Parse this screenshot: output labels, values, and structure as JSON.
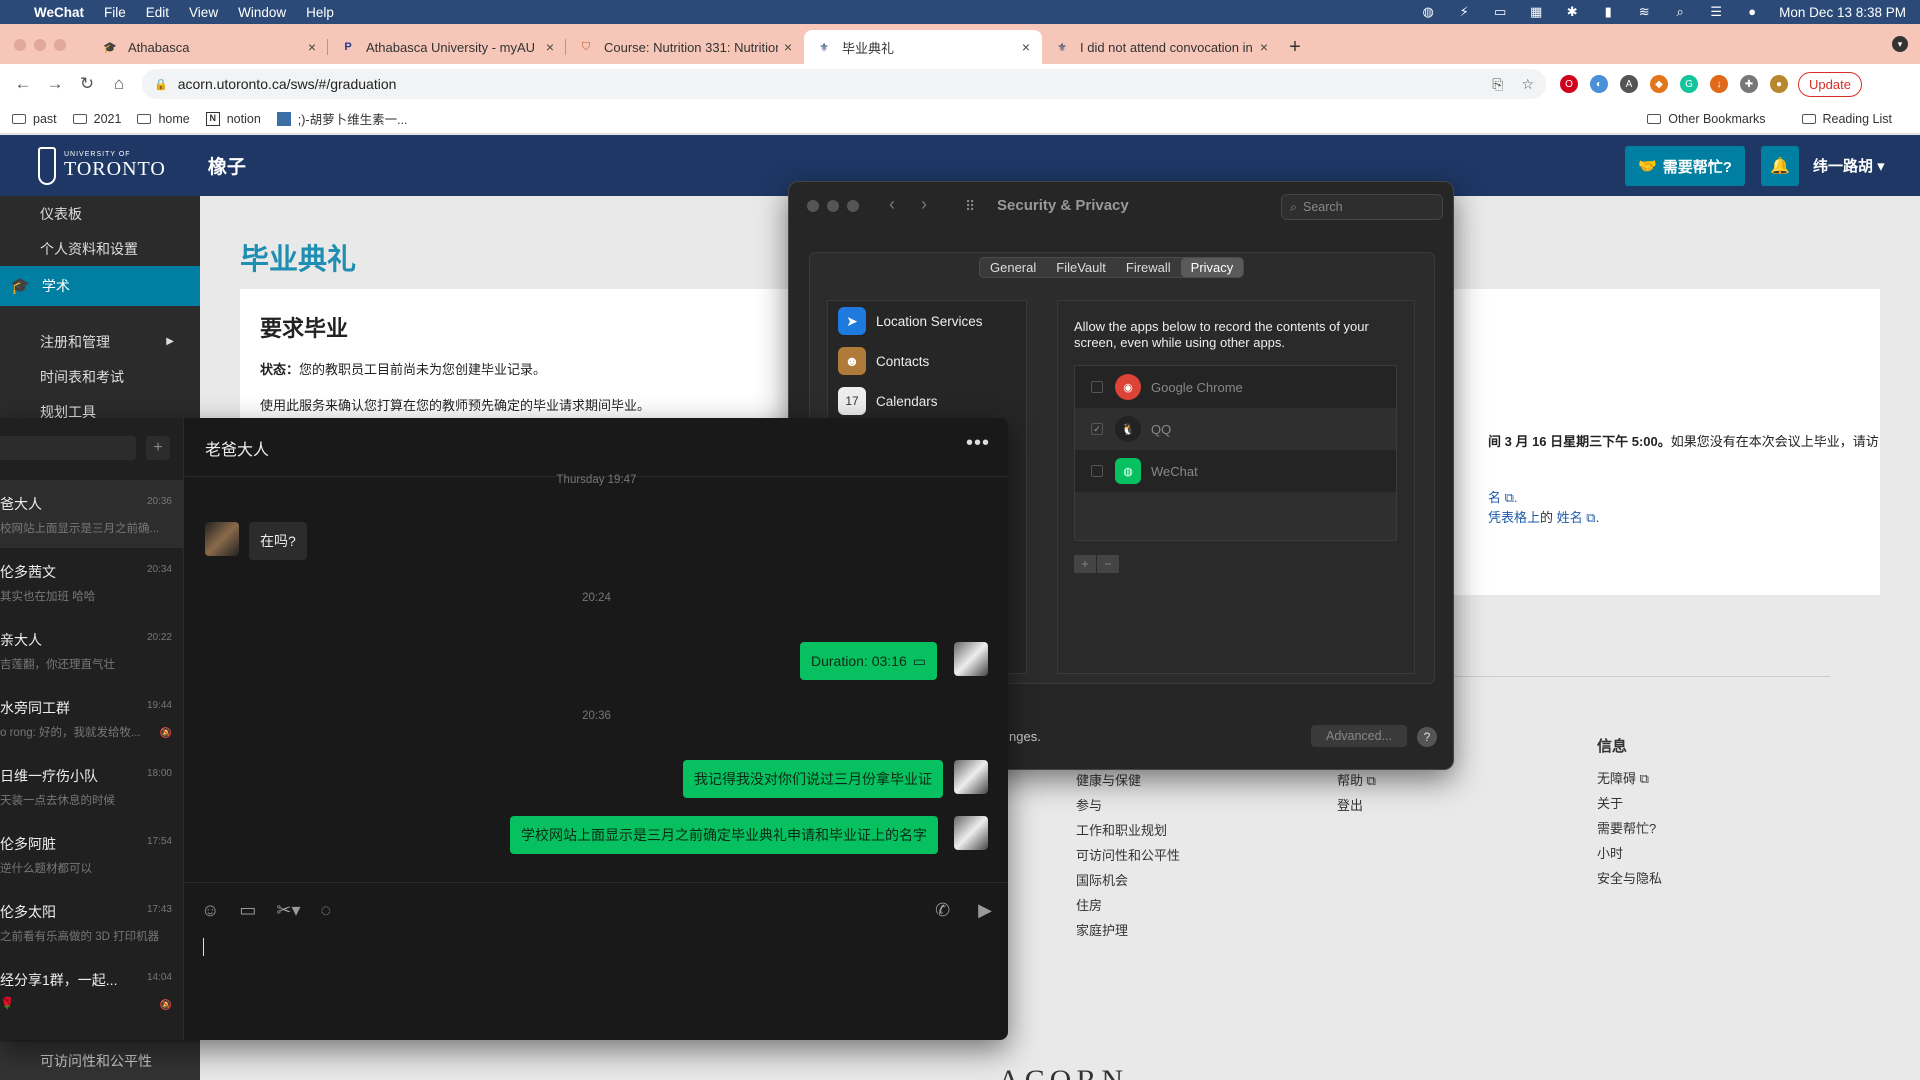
{
  "menubar": {
    "apple": "",
    "app": "WeChat",
    "items": [
      "File",
      "Edit",
      "View",
      "Window",
      "Help"
    ],
    "clock": "Mon Dec 13  8:38 PM"
  },
  "tabs": [
    {
      "title": "Athabasca"
    },
    {
      "title": "Athabasca University - myAU"
    },
    {
      "title": "Course: Nutrition 331: Nutrition"
    },
    {
      "title": "毕业典礼"
    },
    {
      "title": "I did not attend convocation in"
    }
  ],
  "address": {
    "url": "acorn.utoronto.ca/sws/#/graduation",
    "update_label": "Update"
  },
  "bookmarks": {
    "items": [
      "past",
      "2021",
      "home",
      "notion",
      ";)-胡萝卜维生素一..."
    ],
    "other": "Other Bookmarks",
    "reading": "Reading List"
  },
  "uoft": {
    "logo_small": "UNIVERSITY OF",
    "logo_big": "TORONTO",
    "site": "橡子",
    "help": "需要帮忙?",
    "user": "纬一路胡",
    "sidebar": [
      "仪表板",
      "个人资料和设置",
      "学术",
      "注册和管理",
      "时间表和考试",
      "规划工具"
    ],
    "sidebar_bottom": "可访问性和公平性",
    "page_title": "毕业典礼",
    "card_title": "要求毕业",
    "status_label": "状态：",
    "status_text": "您的教职员工目前尚未为您创建毕业记录。",
    "desc": "使用此服务来确认您打算在您的教师预先确定的毕业请求期间毕业。",
    "right_text_pre": "间 3 月 16 日星期三下午 5:00。",
    "right_text_post": "如果您没有在本次会议上毕业，请访",
    "right_link1": "名",
    "right_text2": "凭表格上",
    "right_text2_mid": "的",
    "right_link2": "姓名",
    "footer_col1": [
      "健康与保健",
      "参与",
      "工作和职业规划",
      "可访问性和公平性",
      "国际机会",
      "住房",
      "家庭护理"
    ],
    "footer_col2": [
      "帮助",
      "登出"
    ],
    "footer_col3_title": "信息",
    "footer_col3": [
      "无障碍",
      "关于",
      "需要帮忙?",
      "小时",
      "安全与隐私"
    ],
    "acorn": "ACORN"
  },
  "security": {
    "title": "Security & Privacy",
    "search_placeholder": "Search",
    "tabs": [
      "General",
      "FileVault",
      "Firewall",
      "Privacy"
    ],
    "active_tab": "Privacy",
    "list": [
      "Location Services",
      "Contacts",
      "Calendars"
    ],
    "calendar_day": "17",
    "description": "Allow the apps below to record the contents of your screen, even while using other apps.",
    "apps": [
      {
        "name": "Google Chrome",
        "checked": false
      },
      {
        "name": "QQ",
        "checked": true
      },
      {
        "name": "WeChat",
        "checked": false
      }
    ],
    "plus": "+",
    "minus": "−",
    "bottom_text": "nges.",
    "advanced": "Advanced...",
    "help": "?"
  },
  "wechat": {
    "chat_title": "老爸大人",
    "conversations": [
      {
        "name": "爸大人",
        "time": "20:36",
        "preview": "校网站上面显示是三月之前确..."
      },
      {
        "name": "伦多茜文",
        "time": "20:34",
        "preview": "其实也在加班 哈哈"
      },
      {
        "name": "亲大人",
        "time": "20:22",
        "preview": "吉莲翻，你还理直气壮"
      },
      {
        "name": "水旁同工群",
        "time": "19:44",
        "preview": "o rong: 好的，我就发给牧..."
      },
      {
        "name": "日维一疗伤小队",
        "time": "18:00",
        "preview": "天装一点去休息的时候"
      },
      {
        "name": "伦多阿脏",
        "time": "17:54",
        "preview": "逆什么题材都可以"
      },
      {
        "name": "伦多太阳",
        "time": "17:43",
        "preview": "之前看有乐高做的 3D 打印机器"
      },
      {
        "name": "经分享1群，一起...",
        "time": "14:04",
        "preview": "🌹"
      }
    ],
    "messages": {
      "ts0": "Thursday 19:47",
      "in1": "在吗?",
      "ts1": "20:24",
      "out1": "Duration: 03:16",
      "ts2": "20:36",
      "out2": "我记得我没对你们说过三月份拿毕业证",
      "out3": "学校网站上面显示是三月之前确定毕业典礼申请和毕业证上的名字"
    }
  }
}
